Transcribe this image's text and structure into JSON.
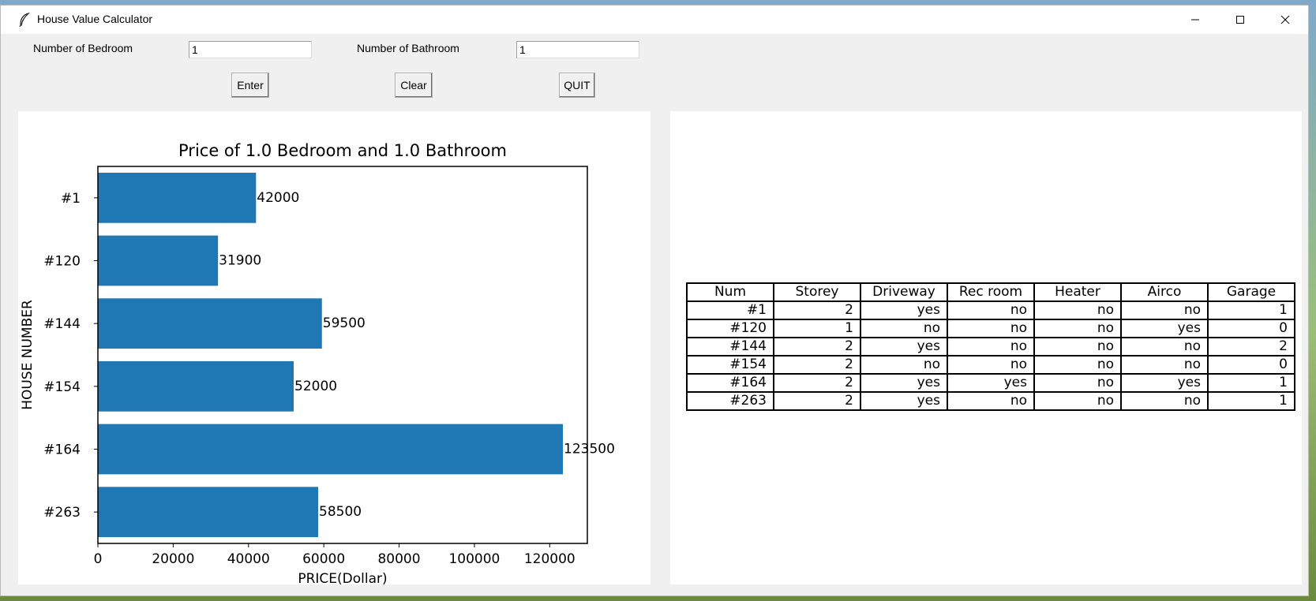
{
  "window": {
    "title": "House Value Calculator"
  },
  "form": {
    "bedroom_label": "Number of Bedroom",
    "bedroom_value": "1",
    "bathroom_label": "Number of Bathroom",
    "bathroom_value": "1",
    "enter_label": "Enter",
    "clear_label": "Clear",
    "quit_label": "QUIT"
  },
  "colors": {
    "bar": "#1f77b4"
  },
  "chart_data": {
    "type": "bar",
    "orientation": "horizontal",
    "title": "Price of 1.0 Bedroom and 1.0 Bathroom",
    "xlabel": "PRICE(Dollar)",
    "ylabel": "HOUSE NUMBER",
    "categories": [
      "#1",
      "#120",
      "#144",
      "#154",
      "#164",
      "#263"
    ],
    "values": [
      42000,
      31900,
      59500,
      52000,
      123500,
      58500
    ],
    "xlim": [
      0,
      130000
    ],
    "xticks": [
      0,
      20000,
      40000,
      60000,
      80000,
      100000,
      120000
    ],
    "grid": false,
    "data_labels": true
  },
  "table": {
    "headers": [
      "Num",
      "Storey",
      "Driveway",
      "Rec room",
      "Heater",
      "Airco",
      "Garage"
    ],
    "rows": [
      [
        "#1",
        "2",
        "yes",
        "no",
        "no",
        "no",
        "1"
      ],
      [
        "#120",
        "1",
        "no",
        "no",
        "no",
        "yes",
        "0"
      ],
      [
        "#144",
        "2",
        "yes",
        "no",
        "no",
        "no",
        "2"
      ],
      [
        "#154",
        "2",
        "no",
        "no",
        "no",
        "no",
        "0"
      ],
      [
        "#164",
        "2",
        "yes",
        "yes",
        "no",
        "yes",
        "1"
      ],
      [
        "#263",
        "2",
        "yes",
        "no",
        "no",
        "no",
        "1"
      ]
    ]
  }
}
